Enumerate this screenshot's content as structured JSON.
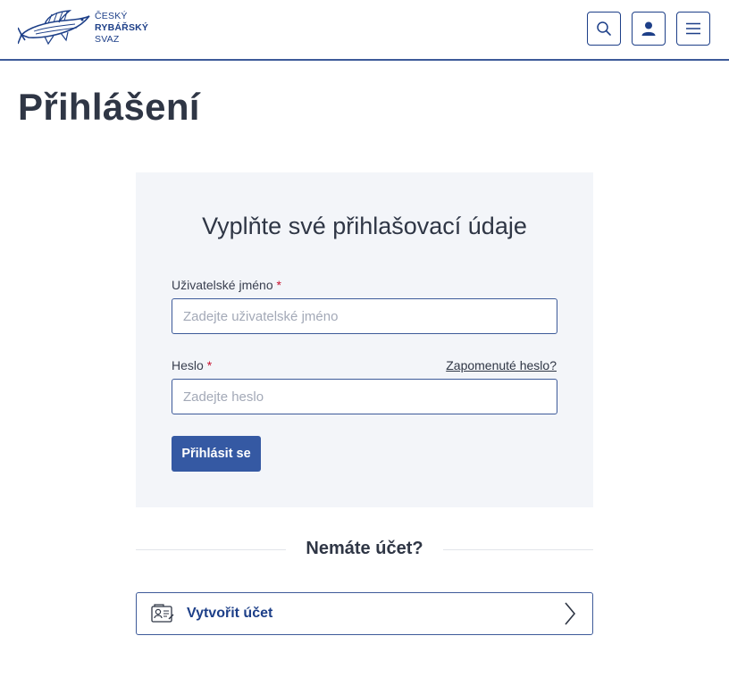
{
  "header": {
    "logo": {
      "line1": "ČESKÝ",
      "line2": "RYBÁŘSKÝ",
      "line3": "SVAZ"
    },
    "icons": {
      "search": "search-icon",
      "user": "user-icon",
      "menu": "hamburger-menu-icon"
    }
  },
  "page": {
    "title": "Přihlášení"
  },
  "login": {
    "heading": "Vyplňte své přihlašovací údaje",
    "username": {
      "label": "Uživatelské jméno",
      "required_mark": "*",
      "placeholder": "Zadejte uživatelské jméno",
      "value": ""
    },
    "password": {
      "label": "Heslo",
      "required_mark": "*",
      "placeholder": "Zadejte heslo",
      "value": ""
    },
    "forgot_link": "Zapomenuté heslo?",
    "submit_label": "Přihlásit se"
  },
  "register": {
    "divider_text": "Nemáte účet?",
    "create_label": "Vytvořit účet",
    "icon": "id-card-icon",
    "arrow_icon": "chevron-right-icon"
  },
  "colors": {
    "brand": "#1d3f88",
    "button": "#3559a3",
    "card_bg": "#f3f5f9",
    "required": "#c8102e"
  }
}
